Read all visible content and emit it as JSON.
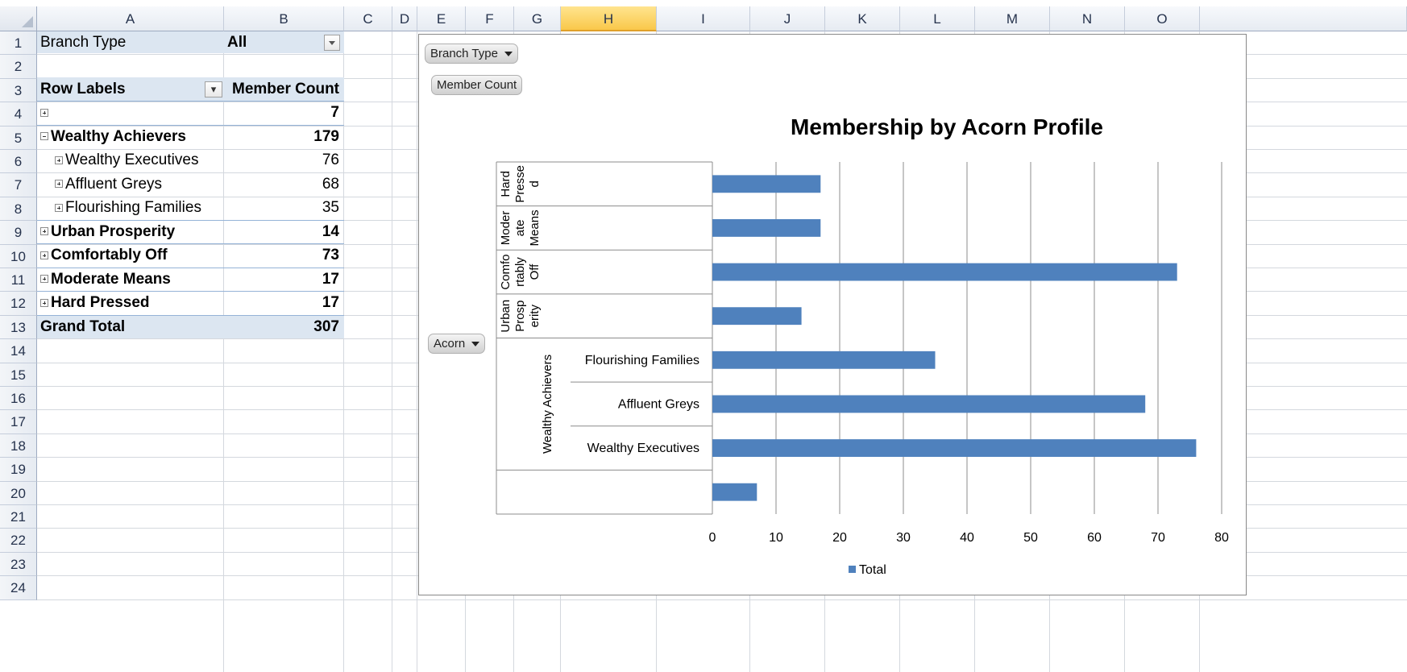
{
  "spreadsheet": {
    "columns": [
      "A",
      "B",
      "C",
      "D",
      "E",
      "F",
      "G",
      "H",
      "I",
      "J",
      "K",
      "L",
      "M",
      "N",
      "O"
    ],
    "selected_column": "H",
    "rows": [
      "1",
      "2",
      "3",
      "4",
      "5",
      "6",
      "7",
      "8",
      "9",
      "10",
      "11",
      "12",
      "13",
      "14",
      "15",
      "16",
      "17",
      "18",
      "19",
      "20",
      "21",
      "22",
      "23",
      "24"
    ]
  },
  "pivot": {
    "filter_label": "Branch Type",
    "filter_value": "All",
    "row_labels_header": "Row Labels",
    "value_header": "Member Count",
    "rows": [
      {
        "label": "",
        "value": "7",
        "level": 0,
        "expand": "plus"
      },
      {
        "label": "Wealthy Achievers",
        "value": "179",
        "level": 0,
        "expand": "minus"
      },
      {
        "label": "Wealthy Executives",
        "value": "76",
        "level": 1,
        "expand": "plus"
      },
      {
        "label": "Affluent Greys",
        "value": "68",
        "level": 1,
        "expand": "plus"
      },
      {
        "label": "Flourishing Families",
        "value": "35",
        "level": 1,
        "expand": "plus"
      },
      {
        "label": "Urban Prosperity",
        "value": "14",
        "level": 0,
        "expand": "plus"
      },
      {
        "label": "Comfortably Off",
        "value": "73",
        "level": 0,
        "expand": "plus"
      },
      {
        "label": "Moderate Means",
        "value": "17",
        "level": 0,
        "expand": "plus"
      },
      {
        "label": "Hard Pressed",
        "value": "17",
        "level": 0,
        "expand": "plus"
      }
    ],
    "grand_total_label": "Grand Total",
    "grand_total_value": "307"
  },
  "chart_buttons": {
    "filter_field": "Branch Type",
    "value_field": "Member Count",
    "axis_field": "Acorn"
  },
  "chart_data": {
    "type": "bar",
    "orientation": "horizontal",
    "title": "Membership by Acorn Profile",
    "series": [
      {
        "name": "Total",
        "color": "#4f81bd"
      }
    ],
    "groups": [
      {
        "name": "Hard Pressed",
        "wrapped_label": [
          "Hard",
          "Presse",
          "d"
        ],
        "items": [
          {
            "label": "",
            "value": 17
          }
        ]
      },
      {
        "name": "Moderate Means",
        "wrapped_label": [
          "Moder",
          "ate",
          "Means"
        ],
        "items": [
          {
            "label": "",
            "value": 17
          }
        ]
      },
      {
        "name": "Comfortably Off",
        "wrapped_label": [
          "Comfo",
          "rtably",
          "Off"
        ],
        "items": [
          {
            "label": "",
            "value": 73
          }
        ]
      },
      {
        "name": "Urban Prosperity",
        "wrapped_label": [
          "Urban",
          "Prosp",
          "erity"
        ],
        "items": [
          {
            "label": "",
            "value": 14
          }
        ]
      },
      {
        "name": "Wealthy Achievers",
        "wrapped_label": [
          "Wealthy Achievers"
        ],
        "items": [
          {
            "label": "Flourishing Families",
            "value": 35
          },
          {
            "label": "Affluent Greys",
            "value": 68
          },
          {
            "label": "Wealthy Executives",
            "value": 76
          }
        ]
      },
      {
        "name": "",
        "wrapped_label": [],
        "items": [
          {
            "label": "",
            "value": 7
          }
        ]
      }
    ],
    "xlim": [
      0,
      80
    ],
    "xticks": [
      0,
      10,
      20,
      30,
      40,
      50,
      60,
      70,
      80
    ],
    "grid": true,
    "legend": "bottom"
  }
}
